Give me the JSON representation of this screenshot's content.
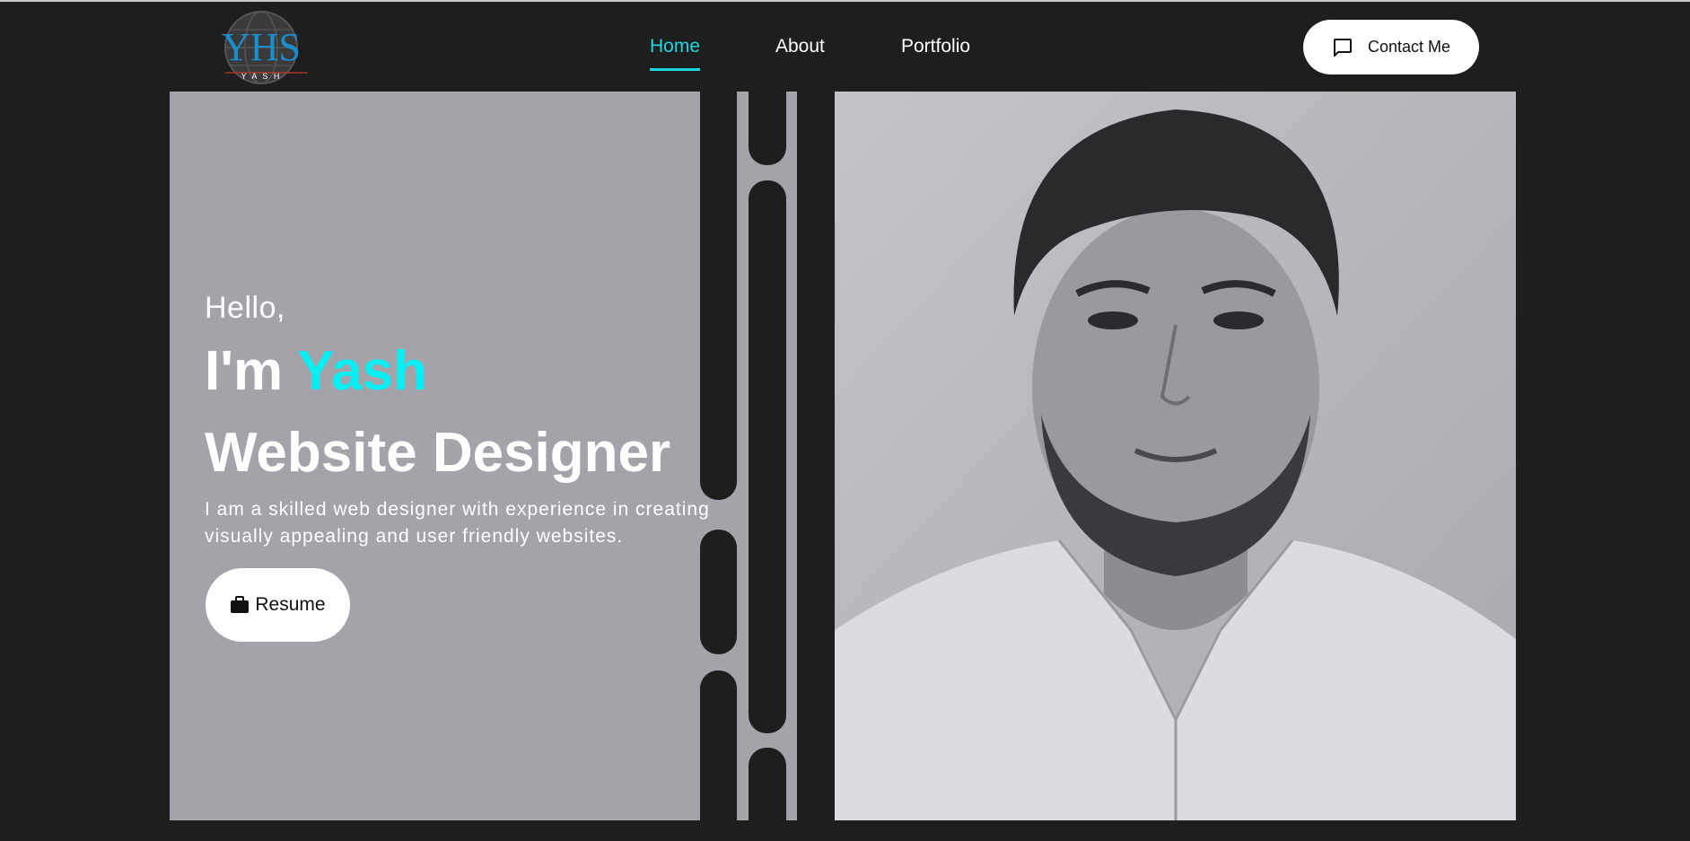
{
  "header": {
    "logo": {
      "text": "YHS",
      "subtext": "Y A S H"
    },
    "nav": [
      {
        "label": "Home",
        "active": true
      },
      {
        "label": "About",
        "active": false
      },
      {
        "label": "Portfolio",
        "active": false
      }
    ],
    "contact_button": {
      "label": "Contact Me",
      "icon": "chat-bubble-icon"
    }
  },
  "hero": {
    "greeting": "Hello,",
    "intro_prefix": "I'm",
    "name": "Yash",
    "role": "Website Designer",
    "description": "I am a skilled web designer with experience in creating visually appealing and user friendly websites.",
    "resume_button": {
      "label": "Resume",
      "icon": "briefcase-icon"
    },
    "photo_alt": "portrait photo"
  },
  "colors": {
    "background": "#1e1e1e",
    "accent": "#1fd6e3",
    "name_highlight": "#00f0f4",
    "panel": "#a4a3a9"
  }
}
